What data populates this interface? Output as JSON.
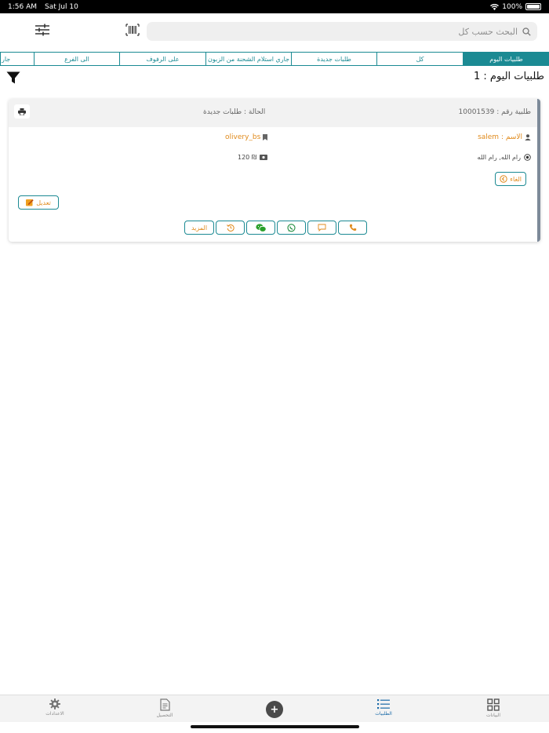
{
  "status_bar": {
    "time": "1:56 AM",
    "date": "Sat Jul 10",
    "battery": "100%"
  },
  "search": {
    "placeholder": "البحث حسب كل"
  },
  "tabs": [
    {
      "label": "طلبيات اليوم",
      "active": true
    },
    {
      "label": "كل",
      "active": false
    },
    {
      "label": "طلبات جديدة",
      "active": false
    },
    {
      "label": "جاري استلام الشحنة من الزبون",
      "active": false
    },
    {
      "label": "على الرفوف",
      "active": false
    },
    {
      "label": "الى الفرع",
      "active": false
    },
    {
      "label": "جار",
      "active": false
    }
  ],
  "list_title": "طلبيات اليوم : 1",
  "order": {
    "number_label": "طلبية رقم : 10001539",
    "status_label": "الحالة : طلبات جديدة",
    "name_label": "الاسم : salem",
    "user": "olivery_bs",
    "address": "رام الله, رام الله",
    "amount": "120 ₪",
    "cancel_label": "الغاء",
    "edit_label": "تعديل",
    "more_label": "المزيد"
  },
  "bottom_nav": {
    "settings": "الاعدادات",
    "collection": "التحصيل",
    "add": "+",
    "orders": "الطلبيات",
    "data": "البيانات"
  },
  "colors": {
    "accent": "#1b8a93",
    "orange": "#e08a1c",
    "nav_active": "#1a6aa8"
  }
}
